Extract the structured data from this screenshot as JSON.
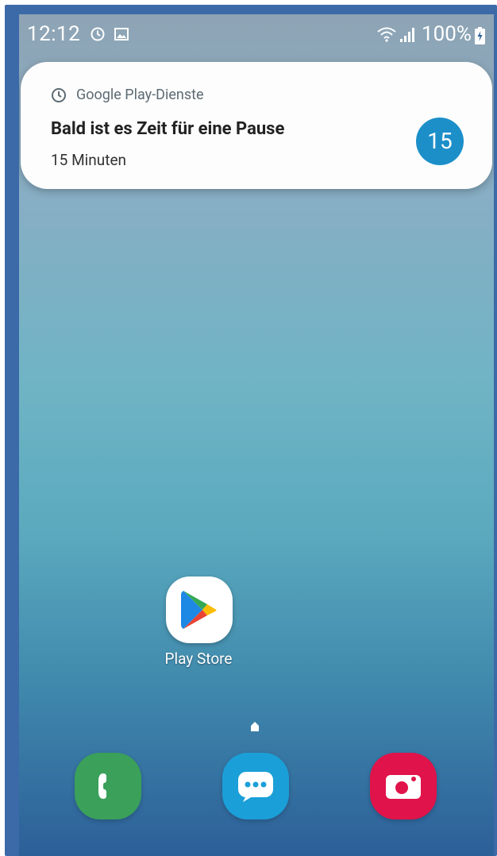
{
  "status_bar": {
    "time": "12:12",
    "battery_text": "100%",
    "icons": [
      "alarm-icon",
      "gallery-icon",
      "wifi-icon",
      "signal-icon",
      "battery-charging-icon"
    ]
  },
  "notification": {
    "app_name": "Google Play-Dienste",
    "title": "Bald ist es Zeit für eine Pause",
    "text": "15 Minuten",
    "badge": "15",
    "badge_color": "#1c8fc9"
  },
  "home": {
    "apps": [
      {
        "label": "Play Store",
        "icon": "play-store-icon"
      }
    ]
  },
  "dock": {
    "apps": [
      {
        "icon": "phone-icon",
        "color": "#3aa05a"
      },
      {
        "icon": "messages-icon",
        "color": "#1b9fd8"
      },
      {
        "icon": "camera-icon",
        "color": "#e0134a"
      }
    ]
  }
}
